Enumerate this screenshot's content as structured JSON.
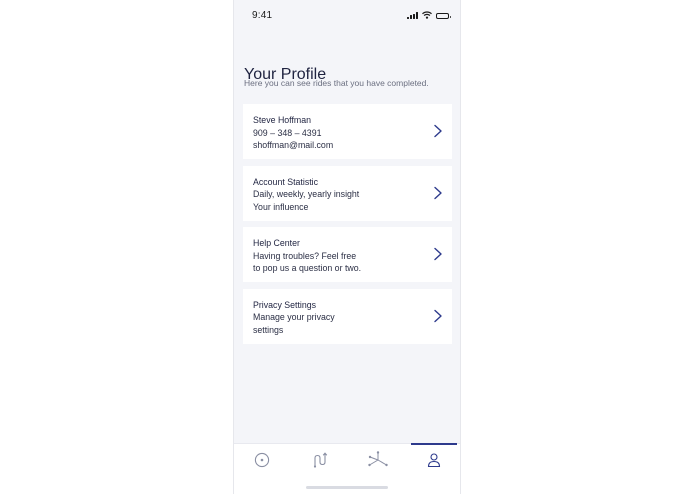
{
  "status_bar": {
    "time": "9:41"
  },
  "header": {
    "title": "Your Profile",
    "subtitle": "Here you can see rides that you have completed."
  },
  "cards": [
    {
      "lines": [
        "Steve Hoffman",
        "909 – 348 – 4391",
        "shoffman@mail.com"
      ],
      "icon": "chevron-right-icon"
    },
    {
      "lines": [
        "Account Statistic",
        "Daily, weekly, yearly insight",
        "Your influence"
      ],
      "icon": "chevron-right-icon"
    },
    {
      "lines": [
        "Help Center",
        "Having troubles? Feel free",
        "to pop us a question or two."
      ],
      "icon": "chevron-right-icon"
    },
    {
      "lines": [
        "Privacy Settings",
        "Manage your privacy",
        "settings"
      ],
      "icon": "chevron-right-icon"
    }
  ],
  "tab_bar": {
    "tabs": [
      {
        "icon": "compass-icon",
        "active": false
      },
      {
        "icon": "route-icon",
        "active": false
      },
      {
        "icon": "network-icon",
        "active": false
      },
      {
        "icon": "profile-icon",
        "active": true
      }
    ]
  },
  "colors": {
    "accent": "#2d3a8c",
    "background": "#f4f5f9",
    "card": "#ffffff",
    "text_primary": "#1f2340",
    "text_secondary": "#6b6f80"
  }
}
